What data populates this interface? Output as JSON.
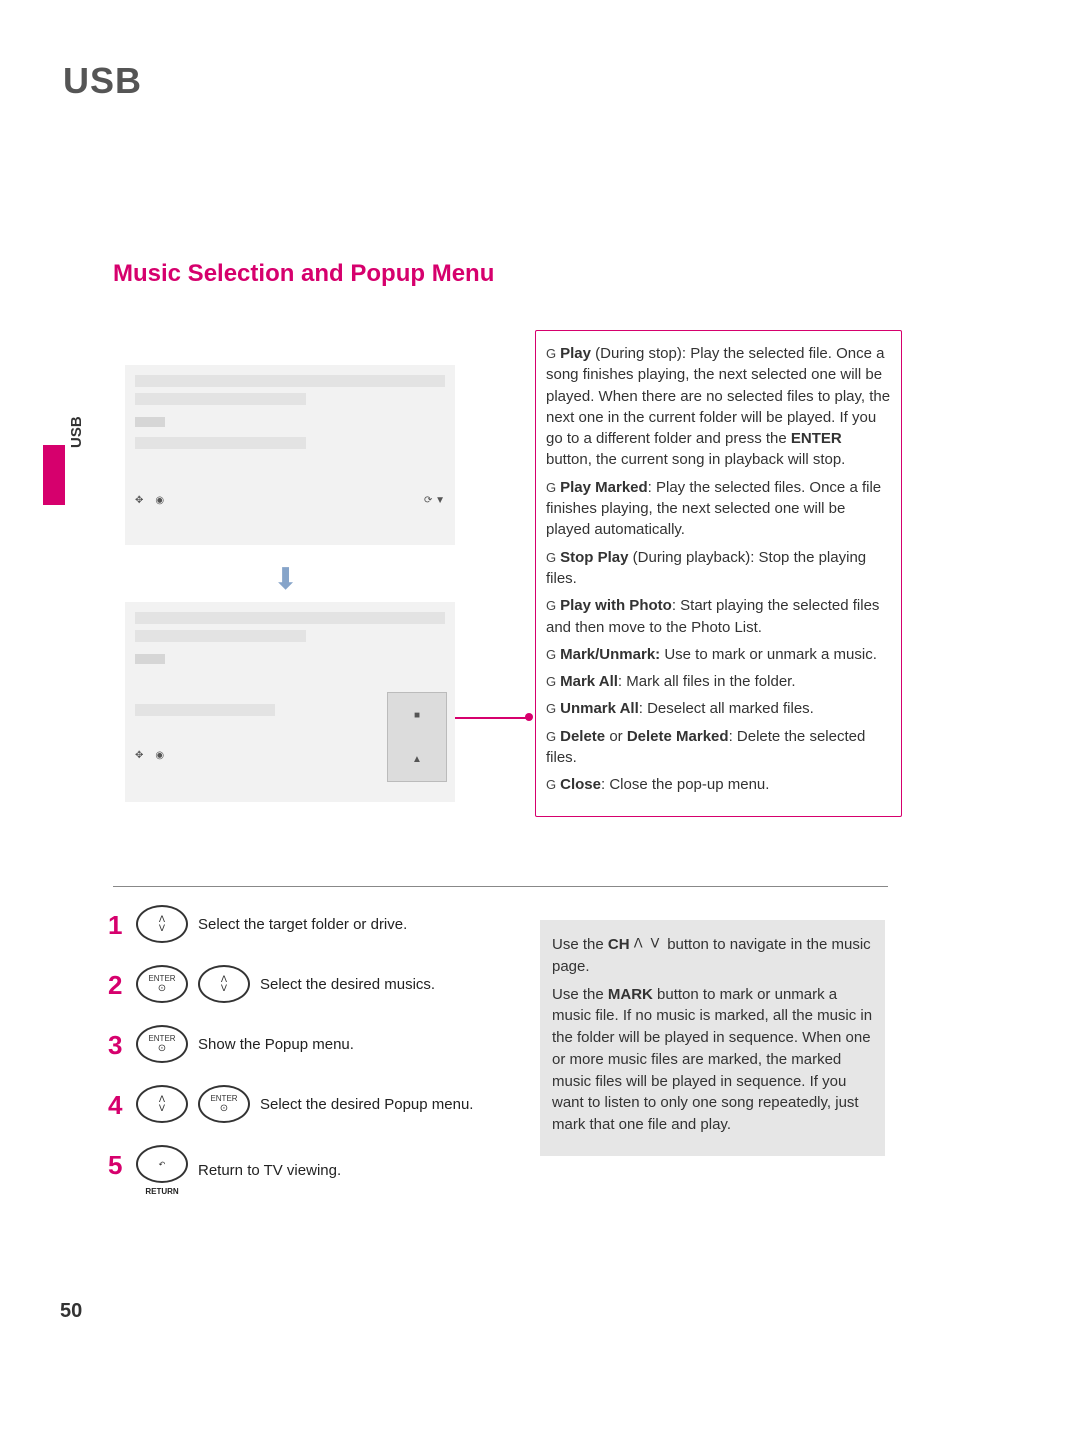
{
  "header": {
    "title": "USB"
  },
  "side_tab": "USB",
  "section_title": "Music Selection and Popup Menu",
  "popup_items": [
    "■",
    "▲"
  ],
  "info": {
    "play_title": "Play",
    "play_suffix": " (During stop): ",
    "play_body": "Play the selected file. Once a song finishes playing, the next selected one will be played. When there are no selected files to play, the next one in the current folder will be played. If you go to a different folder and press the ",
    "play_enter": "ENTER",
    "play_body2": " button, the current song in playback will stop.",
    "play_marked_title": "Play Marked",
    "play_marked_body": ": Play the selected files. Once a file finishes playing, the next selected one will be played automatically.",
    "stop_title": "Stop Play",
    "stop_suffix": " (During playback): ",
    "stop_body": "Stop the playing files.",
    "photo_title": "Play with Photo",
    "photo_body": ": Start playing the selected files and then move to the Photo List.",
    "mark_title": "Mark/Unmark:",
    "mark_body": " Use to mark or unmark a music.",
    "mark_all_title": "Mark All",
    "mark_all_body": ": Mark all files in the folder.",
    "unmark_all_title": "Unmark All",
    "unmark_all_body": ": Deselect all marked files.",
    "delete_title": "Delete",
    "delete_or": " or ",
    "delete_marked": "Delete Marked",
    "delete_body": ": Delete the selected files.",
    "close_title": "Close",
    "close_body": ": Close the pop-up menu."
  },
  "steps": {
    "s1": "Select the target folder or drive.",
    "s2": "Select the desired musics.",
    "s3": "Show the Popup menu.",
    "s4": "Select the desired Popup menu.",
    "s5": "Return to TV viewing."
  },
  "remote_labels": {
    "enter": "ENTER",
    "return": "RETURN"
  },
  "hint": {
    "p1a": "Use the ",
    "p1b": "CH",
    "p1c": " button to navigate in the music page.",
    "p2a": "Use the ",
    "p2b": "MARK",
    "p2c": " button to mark or unmark a music file. If no music is marked, all the music in the folder will be played in sequence. When one or more music files are marked, the marked music files will be played in sequence. If you want to listen to only one song repeatedly, just mark that one file and play."
  },
  "page_number": "50"
}
